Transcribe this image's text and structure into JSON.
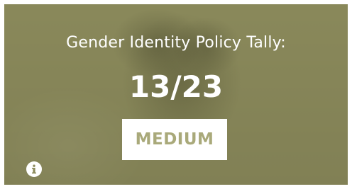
{
  "card": {
    "title": "Gender Identity Policy Tally:",
    "score": "13/23",
    "rating": "MEDIUM",
    "info_icon": "info-icon"
  },
  "colors": {
    "card_background": "#8c8b5c",
    "rating_text": "#a9a97a",
    "text": "#ffffff"
  }
}
